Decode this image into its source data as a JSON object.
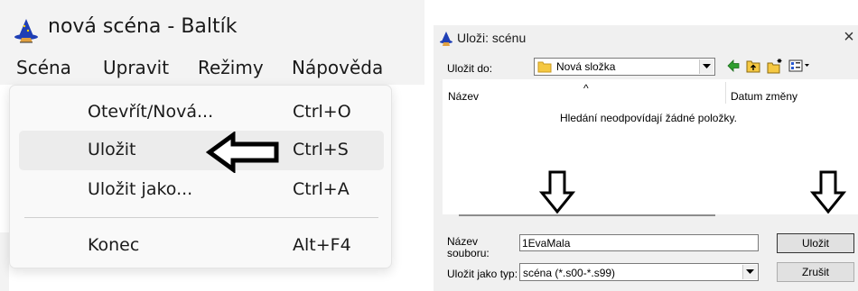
{
  "left_window": {
    "title": "nová scéna - Baltík",
    "menubar": [
      "Scéna",
      "Upravit",
      "Režimy",
      "Nápověda"
    ],
    "menu_items": [
      {
        "label": "Otevřít/Nová...",
        "shortcut": "Ctrl+O"
      },
      {
        "label": "Uložit",
        "shortcut": "Ctrl+S"
      },
      {
        "label": "Uložit jako...",
        "shortcut": "Ctrl+A"
      },
      {
        "label": "Konec",
        "shortcut": "Alt+F4"
      }
    ],
    "highlighted_item": "Uložit"
  },
  "dialog": {
    "title": "Uloži: scénu",
    "close_glyph": "×",
    "save_in_label": "Uložit do:",
    "save_in_value": "Nová složka",
    "columns": {
      "name": "Název",
      "sort_glyph": "^",
      "date": "Datum změny"
    },
    "empty_message": "Hledání neodpovídají žádné položky.",
    "filename_label": [
      "Název",
      "souboru:"
    ],
    "filename_value": "1EvaMala",
    "filetype_label": "Uložit jako typ:",
    "filetype_value": "scéna (*.s00-*.s99)",
    "buttons": {
      "save": "Uložit",
      "cancel": "Zrušit"
    }
  },
  "colors": {
    "highlight": "#ececec",
    "dialog_bg": "#f0f0f0",
    "folder": "#f5c842",
    "wizard_hat": "#1f3fb5"
  },
  "icons": [
    "wizard-icon",
    "folder-icon",
    "back-arrow-icon",
    "up-folder-icon",
    "new-folder-icon",
    "views-icon",
    "chevron-down-icon",
    "arrow-left-icon",
    "arrow-down-icon"
  ]
}
